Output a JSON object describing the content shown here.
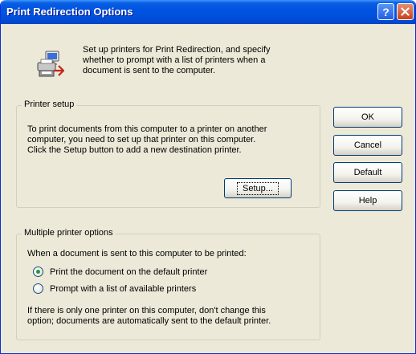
{
  "window": {
    "title": "Print Redirection Options",
    "help_glyph": "?",
    "close_glyph": "X"
  },
  "intro": {
    "icon": "printer-redirection-icon",
    "text": "Set up printers for Print Redirection, and specify\nwhether to prompt with a list of printers when a\ndocument is sent to the computer."
  },
  "printer_setup": {
    "legend": "Printer setup",
    "description": "To print documents from this computer to a printer on another\ncomputer, you need to set up that printer on this computer.\nClick the Setup button to add a new destination printer.",
    "setup_button": "Setup..."
  },
  "multiple_printer_options": {
    "legend": "Multiple printer options",
    "question": "When a document is sent to this computer to be printed:",
    "options": [
      {
        "label": "Print the document on the default printer",
        "selected": true
      },
      {
        "label": "Prompt with a list of available printers",
        "selected": false
      }
    ],
    "note": "If there is only one printer on this computer, don't change this\noption; documents are automatically sent to the default printer."
  },
  "buttons": {
    "ok": "OK",
    "cancel": "Cancel",
    "default": "Default",
    "help": "Help"
  },
  "colors": {
    "titlebar": "#0053e1",
    "dialog_background": "#ece9d8",
    "close_button": "#c8401c",
    "radio_dot": "#1f9a3a"
  }
}
